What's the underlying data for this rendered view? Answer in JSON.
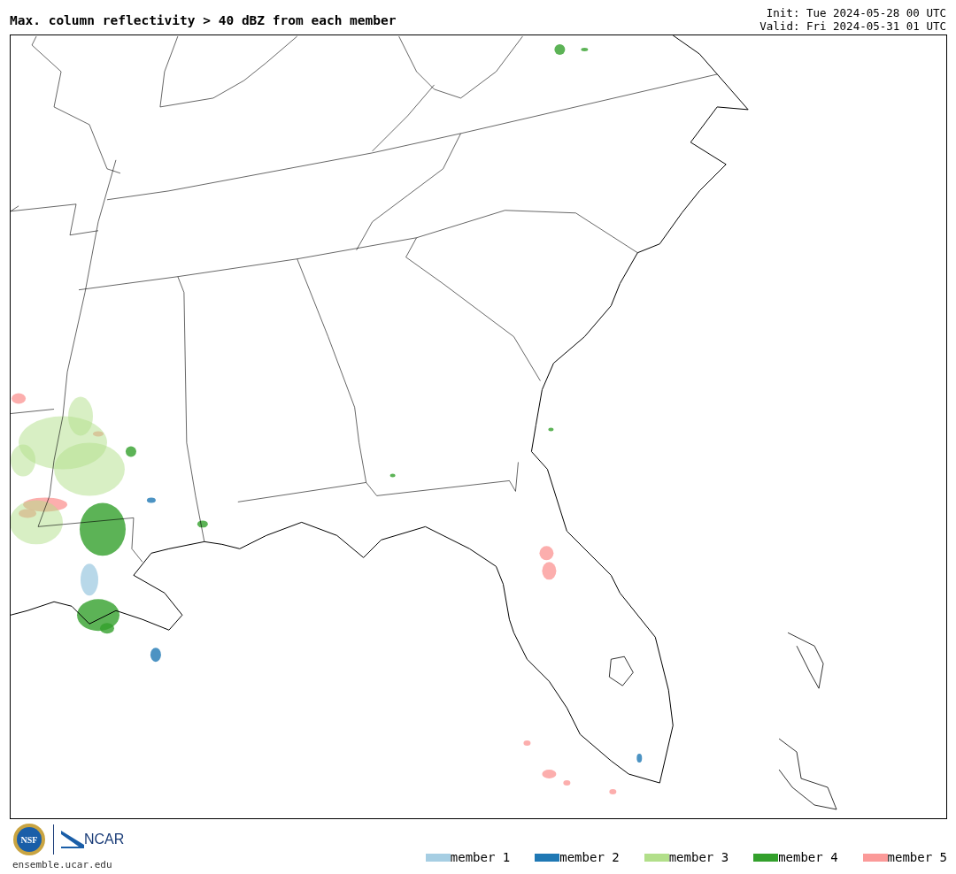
{
  "title": "Max. column reflectivity > 40 dBZ from each member",
  "init": "Init: Tue 2024-05-28 00 UTC",
  "valid": "Valid: Fri 2024-05-31 01 UTC",
  "logos": {
    "nsf": "NSF",
    "ncar": "NCAR"
  },
  "site": "ensemble.ucar.edu",
  "legend": [
    {
      "label": "member 1",
      "color": "#a6cee3"
    },
    {
      "label": "member 2",
      "color": "#1f78b4"
    },
    {
      "label": "member 3",
      "color": "#b2df8a"
    },
    {
      "label": "member 4",
      "color": "#33a02c"
    },
    {
      "label": "member 5",
      "color": "#fb9a99"
    }
  ]
}
